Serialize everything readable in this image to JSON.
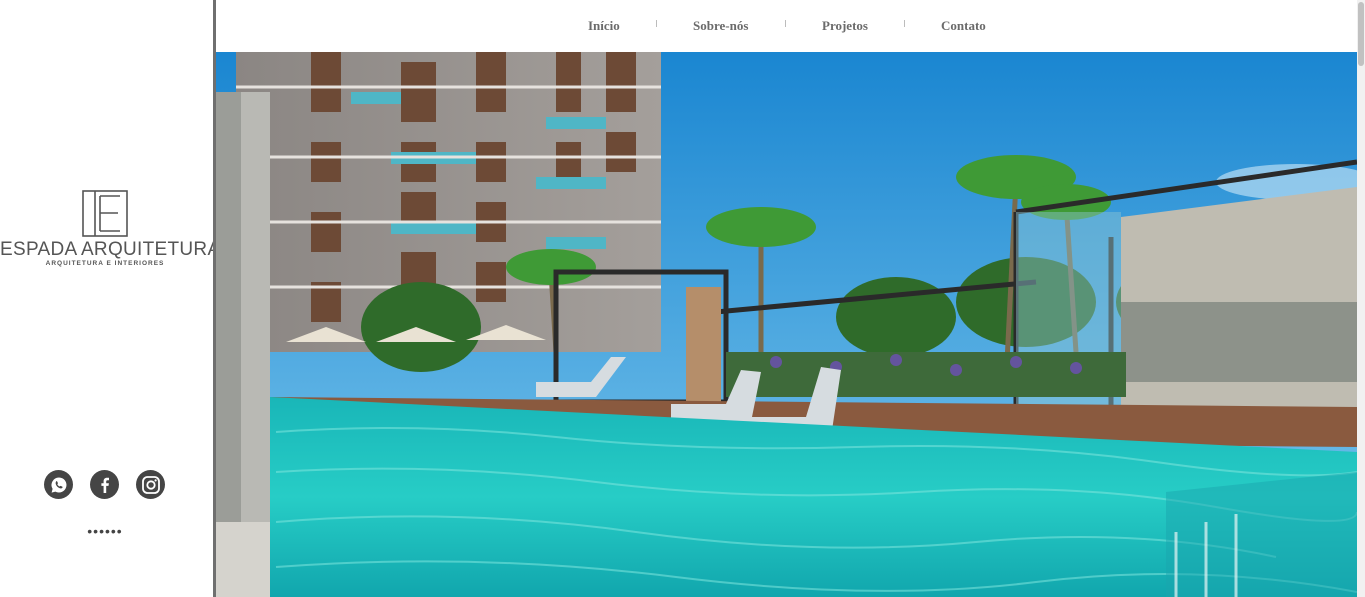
{
  "brand": {
    "name": "ESPADA ARQUITETURA",
    "tagline": "ARQUITETURA E INTERIORES"
  },
  "nav": {
    "items": [
      "Início",
      "Sobre-nós",
      "Projetos",
      "Contato"
    ]
  },
  "social": {
    "icons": [
      "whatsapp-icon",
      "facebook-icon",
      "instagram-icon"
    ]
  },
  "slider": {
    "dots": "••••••"
  },
  "colors": {
    "sidebar_border": "#6f6f6f",
    "nav_text": "#6b6b6b",
    "icon_bg": "#454545",
    "pool": "#1fc4c0",
    "sky": "#1f8fd6"
  }
}
